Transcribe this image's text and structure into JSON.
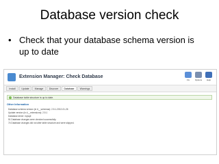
{
  "slide": {
    "title": "Database version check",
    "bullet_symbol": "•",
    "bullet": "Check that your database schema version is up to date"
  },
  "app": {
    "window_title": "Extension Manager: Check Database",
    "toolbar": [
      {
        "label": "Fix",
        "color": "#5b8fd8",
        "icon": "fix-icon"
      },
      {
        "label": "Options",
        "color": "#7a8fb0",
        "icon": "options-icon"
      },
      {
        "label": "Help",
        "color": "#3f6fb8",
        "icon": "help-icon"
      }
    ],
    "tabs": [
      "Install",
      "Update",
      "Manage",
      "Discover",
      "Database",
      "Warnings"
    ],
    "active_tab": "Database",
    "message": "Database table structure is up to date.",
    "info_heading": "Other Information",
    "info_lines": [
      "Database schema version (in #__schemas): 2.5.1-2012-01-26",
      "Update version (in #__extensions): 2.5.1",
      "Database driver: mysqli",
      "51 Database changes were checked successfully.",
      "74 Database changes did not alter table structure and were skipped."
    ]
  }
}
